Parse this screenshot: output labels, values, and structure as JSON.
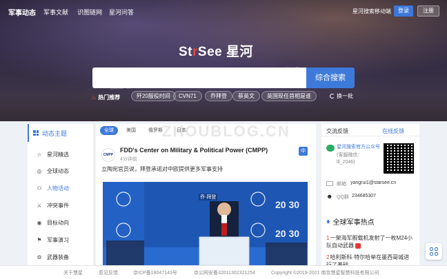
{
  "header": {
    "site_name": "军事动态",
    "nav": [
      "军事文献",
      "识图链网",
      "星河问答"
    ],
    "mobile_link": "星河搜索移动端",
    "login": "登录",
    "register": "注册",
    "brand_prefix": "St",
    "brand_pin": "r",
    "brand_suffix": "See 星河"
  },
  "search": {
    "placeholder": "",
    "button": "综合搜索"
  },
  "hot": {
    "label": "热门推荐",
    "tags": [
      "歼20服役时间",
      "CVN71",
      "乔拜登",
      "蔡英文",
      "英国现任首相是谁"
    ],
    "refresh": "换一批"
  },
  "sidebar": {
    "title": "动态主题",
    "items": [
      {
        "label": "星河精选",
        "icon": "star-icon"
      },
      {
        "label": "全球动态",
        "icon": "globe-icon"
      },
      {
        "label": "人物活动",
        "icon": "person-icon"
      },
      {
        "label": "冲突事件",
        "icon": "conflict-icon"
      },
      {
        "label": "目标动向",
        "icon": "target-icon"
      },
      {
        "label": "军事演习",
        "icon": "flag-icon"
      },
      {
        "label": "武器装备",
        "icon": "weapon-icon"
      }
    ]
  },
  "countries": [
    "全球",
    "美国",
    "俄罗斯",
    "日本"
  ],
  "card": {
    "logo": "CMPP",
    "title": "FDD's Center on Military & Political Power (CMPP)",
    "time": "4分钟前",
    "lang": "中",
    "text": "立陶宛官员说，拜登承诺对中欧提供更多军事支持",
    "image_label": "乔·拜登",
    "nato_text": "20 30"
  },
  "right": {
    "title": "交流反馈",
    "link": "在线反馈",
    "wechat_title": "星河搜索官方公众号",
    "wechat_sub": "(客服微信：",
    "wechat_id": "lll_2046)",
    "mail_label": "邮箱",
    "mail_value": "yangrui1@starsee.cn",
    "qq_label": "QQ群",
    "qq_value": "234685307"
  },
  "hot_news": {
    "title": "全球军事热点",
    "items": [
      {
        "num": "1",
        "text": "一架海军舰载机发射了一枚M24小队自动武器"
      },
      {
        "num": "2",
        "text": "哈利斯科·特尔哈举在墨西哥城进行了基础..."
      }
    ]
  },
  "footer": {
    "items": [
      "关于慧星",
      "意见反馈",
      "京ICP备18047143号",
      "京公网安备32011302321254",
      "Copyright ©2019-2021 南京慧星智慧科技有限公司"
    ]
  },
  "watermark": "ZHOUBLOG.CN"
}
